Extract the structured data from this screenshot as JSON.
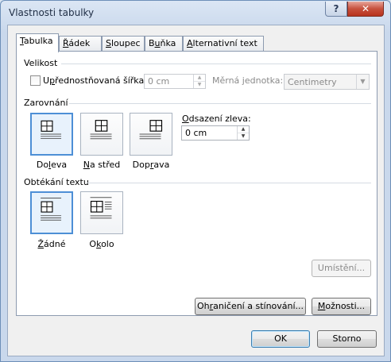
{
  "window": {
    "title": "Vlastnosti tabulky",
    "help_glyph": "?",
    "close_glyph": "✕"
  },
  "tabs": [
    {
      "pre": "",
      "key": "T",
      "post": "abulka",
      "active": true
    },
    {
      "pre": "",
      "key": "Ř",
      "post": "ádek",
      "active": false
    },
    {
      "pre": "",
      "key": "S",
      "post": "loupec",
      "active": false
    },
    {
      "pre": "B",
      "key": "u",
      "post": "ňka",
      "active": false
    },
    {
      "pre": "",
      "key": "A",
      "post": "lternativní text",
      "active": false
    }
  ],
  "size": {
    "group_label": "Velikost",
    "preferred_width": {
      "pre": "U",
      "key": "p",
      "post": "řednostňovaná šířka:",
      "checked": false
    },
    "width_value": "0 cm",
    "unit_label": "Měrná jednotka:",
    "unit_value": "Centimetry"
  },
  "alignment": {
    "group_label": "Zarovnání",
    "options": [
      {
        "pre": "Do",
        "key": "l",
        "post": "eva",
        "selected": true
      },
      {
        "pre": "",
        "key": "N",
        "post": "a střed",
        "selected": false
      },
      {
        "pre": "Dop",
        "key": "r",
        "post": "ava",
        "selected": false
      }
    ],
    "indent_label": {
      "pre": "",
      "key": "O",
      "post": "dsazení zleva:"
    },
    "indent_value": "0 cm"
  },
  "wrapping": {
    "group_label": "Obtékání textu",
    "options": [
      {
        "pre": "",
        "key": "Ž",
        "post": "ádné",
        "selected": true
      },
      {
        "pre": "O",
        "key": "k",
        "post": "olo",
        "selected": false
      }
    ],
    "positioning_button": "Umístění..."
  },
  "buttons": {
    "borders": {
      "pre": "Oh",
      "key": "r",
      "post": "aničení a stínování..."
    },
    "options": {
      "pre": "",
      "key": "M",
      "post": "ožnosti..."
    },
    "ok": "OK",
    "cancel": "Storno"
  }
}
